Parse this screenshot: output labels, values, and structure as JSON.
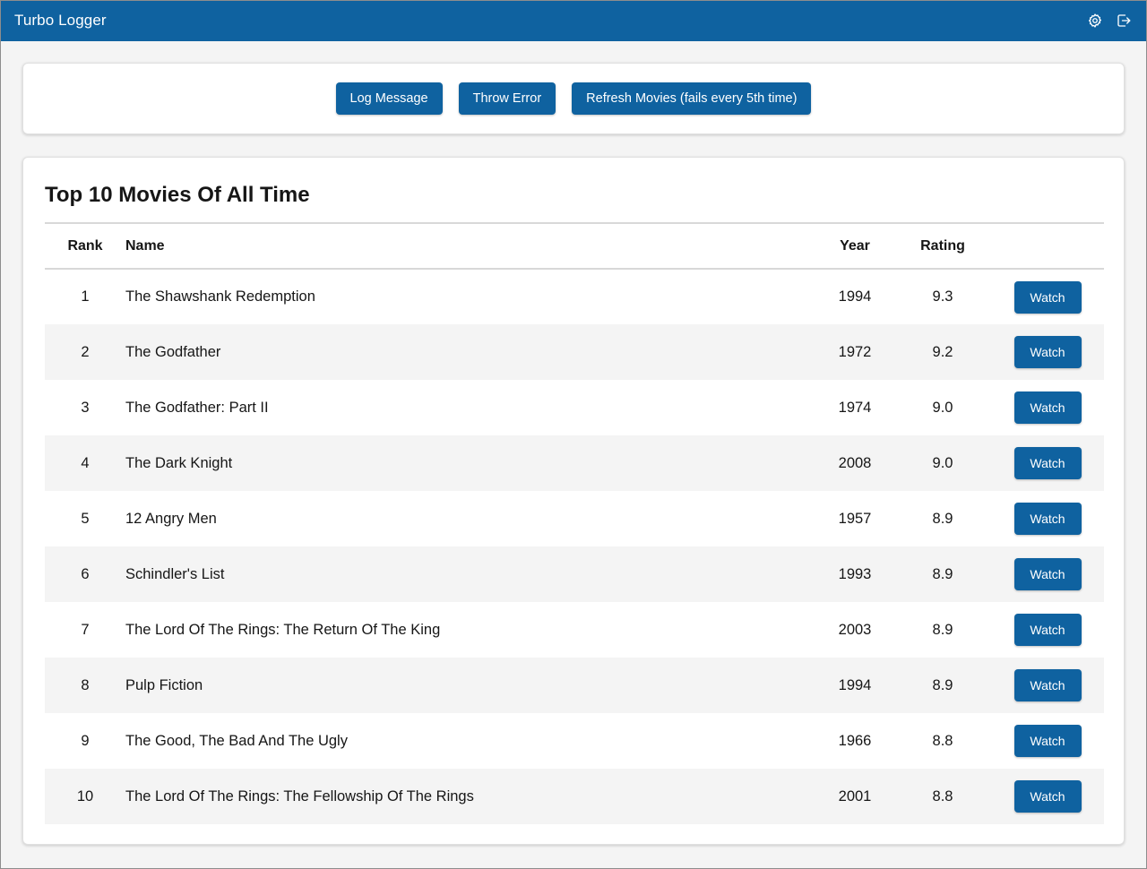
{
  "app": {
    "title": "Turbo Logger",
    "icons": [
      "gear-icon",
      "logout-icon"
    ]
  },
  "actions": {
    "log_message": "Log Message",
    "throw_error": "Throw Error",
    "refresh_movies": "Refresh Movies (fails every 5th time)"
  },
  "movies": {
    "title": "Top 10 Movies Of All Time",
    "columns": {
      "rank": "Rank",
      "name": "Name",
      "year": "Year",
      "rating": "Rating"
    },
    "watch_label": "Watch",
    "rows": [
      {
        "rank": "1",
        "name": "The Shawshank Redemption",
        "year": "1994",
        "rating": "9.3"
      },
      {
        "rank": "2",
        "name": "The Godfather",
        "year": "1972",
        "rating": "9.2"
      },
      {
        "rank": "3",
        "name": "The Godfather: Part II",
        "year": "1974",
        "rating": "9.0"
      },
      {
        "rank": "4",
        "name": "The Dark Knight",
        "year": "2008",
        "rating": "9.0"
      },
      {
        "rank": "5",
        "name": "12 Angry Men",
        "year": "1957",
        "rating": "8.9"
      },
      {
        "rank": "6",
        "name": "Schindler's List",
        "year": "1993",
        "rating": "8.9"
      },
      {
        "rank": "7",
        "name": "The Lord Of The Rings: The Return Of The King",
        "year": "2003",
        "rating": "8.9"
      },
      {
        "rank": "8",
        "name": "Pulp Fiction",
        "year": "1994",
        "rating": "8.9"
      },
      {
        "rank": "9",
        "name": "The Good, The Bad And The Ugly",
        "year": "1966",
        "rating": "8.8"
      },
      {
        "rank": "10",
        "name": "The Lord Of The Rings: The Fellowship Of The Rings",
        "year": "2001",
        "rating": "8.8"
      }
    ]
  },
  "colors": {
    "brand": "#0f62a0",
    "background": "#f4f4f4",
    "stripe": "#f4f4f4"
  }
}
